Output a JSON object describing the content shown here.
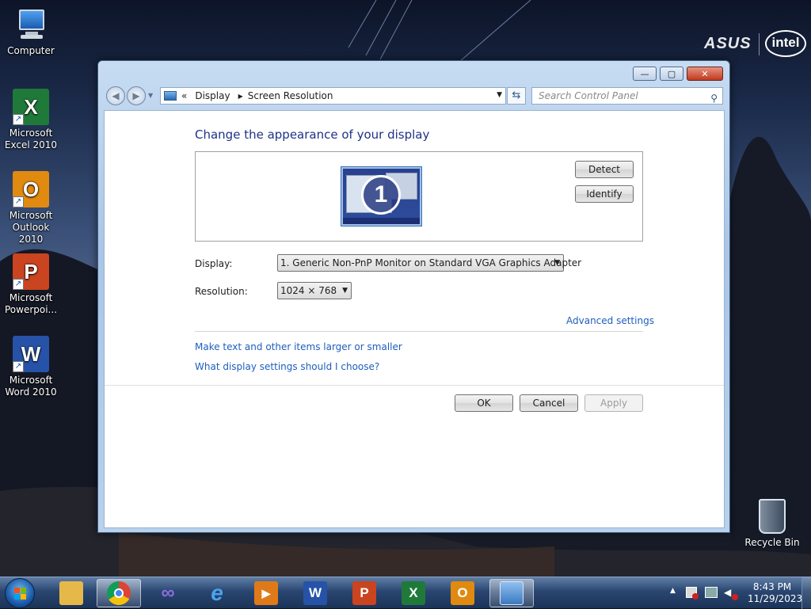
{
  "desktop": {
    "brand": {
      "asus": "ASUS",
      "intel": "intel"
    },
    "icons": [
      {
        "label": "Computer",
        "icon": "computer-icon"
      },
      {
        "label": "Microsoft Excel 2010",
        "icon": "excel-icon",
        "letter": "X",
        "color": "#1f7a3a"
      },
      {
        "label": "Microsoft Outlook 2010",
        "icon": "outlook-icon",
        "letter": "O",
        "color": "#e08a10"
      },
      {
        "label": "Microsoft Powerpoi...",
        "icon": "powerpoint-icon",
        "letter": "P",
        "color": "#c9441f"
      },
      {
        "label": "Microsoft Word 2010",
        "icon": "word-icon",
        "letter": "W",
        "color": "#2653a8"
      }
    ],
    "recycle_bin": {
      "label": "Recycle Bin",
      "icon": "recycle-bin-icon"
    }
  },
  "window": {
    "controls": {
      "minimize": "—",
      "maximize": "▢",
      "close": "✕"
    },
    "address": {
      "prefix": "«",
      "crumbs": [
        "Display",
        "Screen Resolution"
      ]
    },
    "search_placeholder": "Search Control Panel",
    "heading": "Change the appearance of your display",
    "monitor_number": "1",
    "detect_label": "Detect",
    "identify_label": "Identify",
    "display_label": "Display:",
    "display_value": "1. Generic Non-PnP Monitor on Standard VGA Graphics Adapter",
    "resolution_label": "Resolution:",
    "resolution_value": "1024 × 768",
    "advanced_link": "Advanced settings",
    "link_text_size": "Make text and other items larger or smaller",
    "link_help": "What display settings should I choose?",
    "ok_label": "OK",
    "cancel_label": "Cancel",
    "apply_label": "Apply"
  },
  "taskbar": {
    "apps": [
      {
        "name": "windows-explorer",
        "icon": "folder-icon",
        "color": "#e6b84a"
      },
      {
        "name": "chrome",
        "icon": "chrome-icon",
        "color": "#db4437",
        "active": true
      },
      {
        "name": "visual-studio",
        "icon": "infinity-icon",
        "color": "#5b3fa8"
      },
      {
        "name": "internet-explorer",
        "icon": "ie-icon",
        "color": "#2a86d8",
        "letter": "e"
      },
      {
        "name": "media-player",
        "icon": "media-player-icon",
        "color": "#e07a18"
      },
      {
        "name": "word",
        "icon": "word-icon",
        "color": "#2653a8",
        "letter": "W"
      },
      {
        "name": "powerpoint",
        "icon": "powerpoint-icon",
        "color": "#c9441f",
        "letter": "P"
      },
      {
        "name": "excel",
        "icon": "excel-icon",
        "color": "#1f7a3a",
        "letter": "X"
      },
      {
        "name": "outlook",
        "icon": "outlook-icon",
        "color": "#e08a10",
        "letter": "O"
      },
      {
        "name": "control-panel",
        "icon": "control-panel-icon",
        "color": "#4a86c8",
        "active": true
      }
    ],
    "tray": {
      "show_hidden": "▲"
    },
    "time": "8:43 PM",
    "date": "11/29/2023"
  }
}
